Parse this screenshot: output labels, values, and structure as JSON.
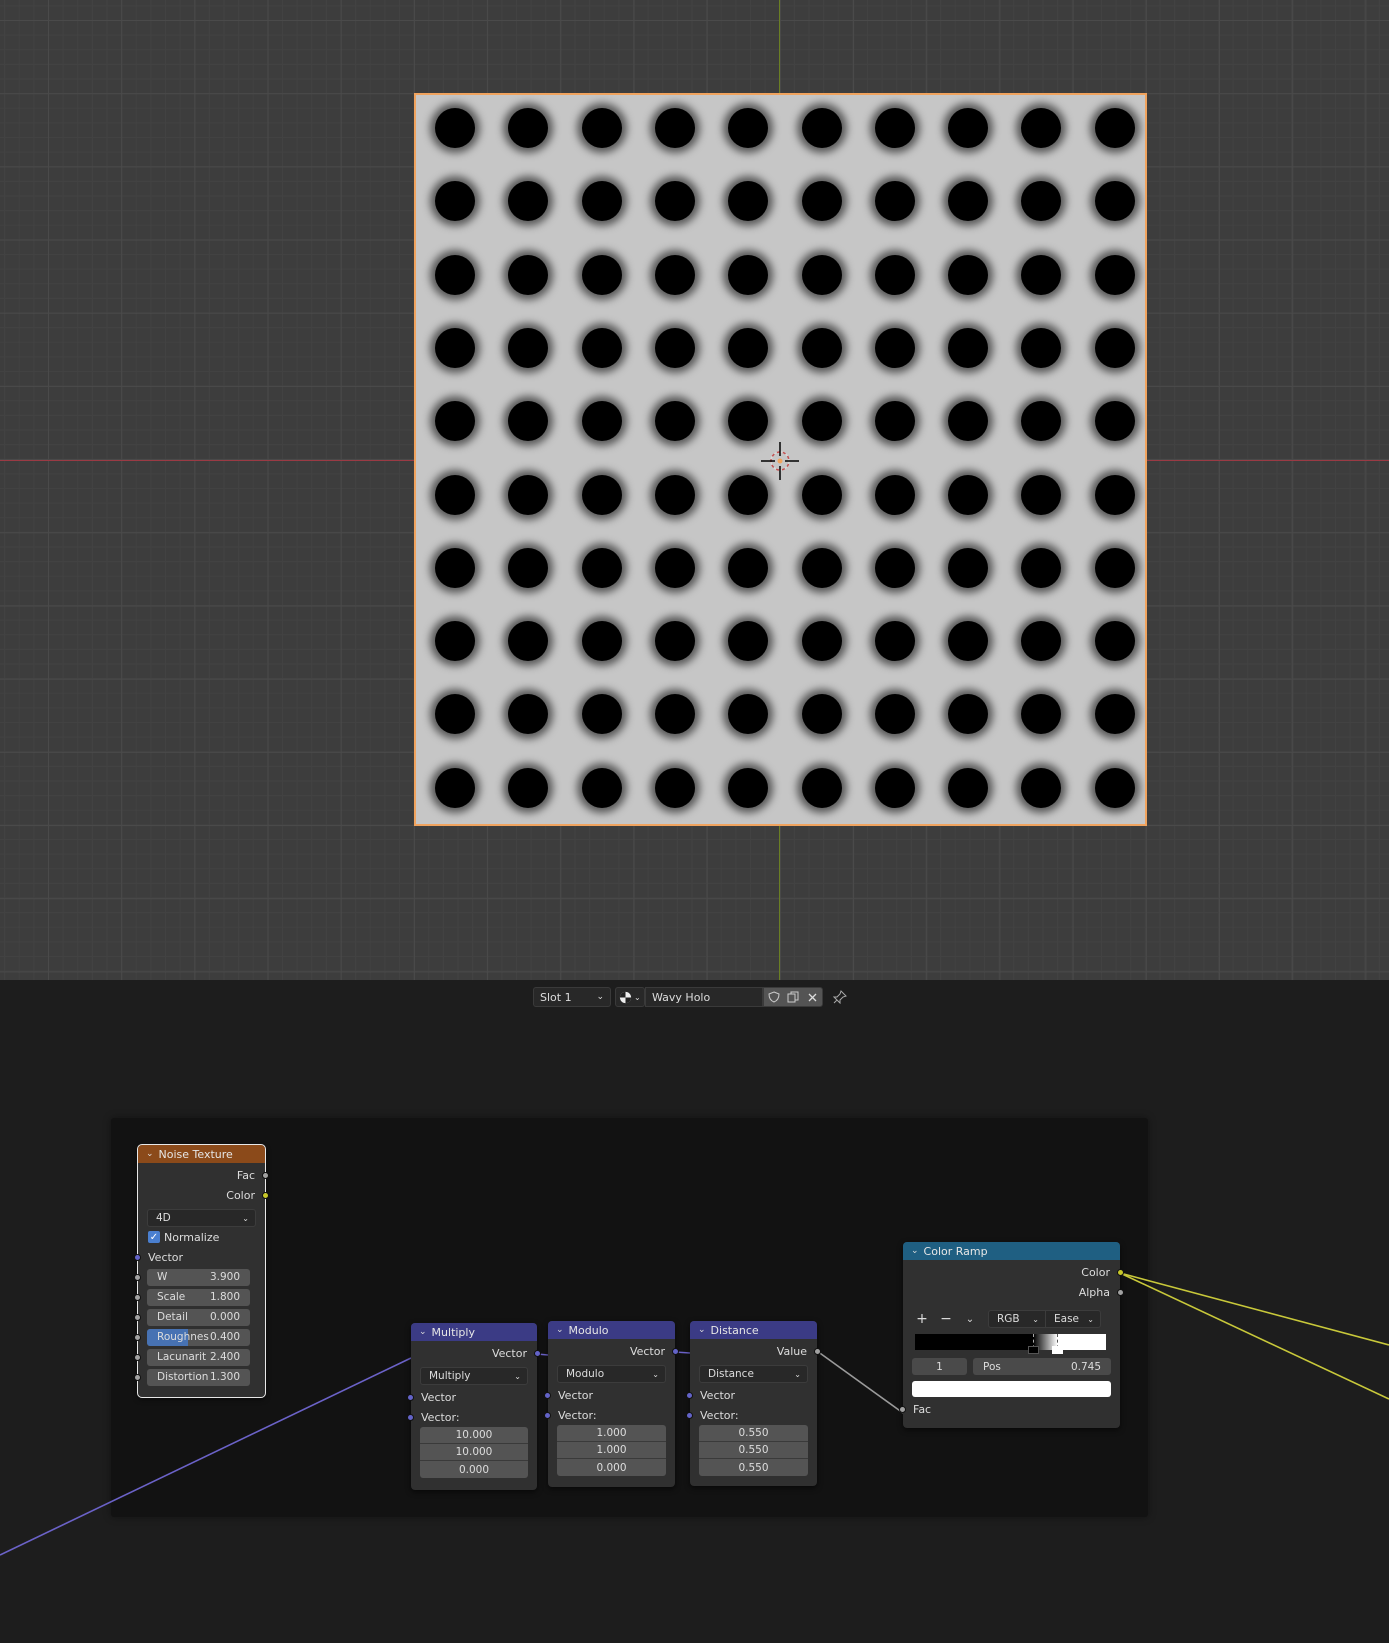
{
  "viewport": {
    "plane": {
      "rows": 10,
      "cols": 10,
      "outline_color": "#f0a35e",
      "surface_color": "#c6c6c6",
      "dot_color": "#000000"
    },
    "axis_colors": {
      "x": "#9a3a44",
      "y": "#6b7f24"
    }
  },
  "header": {
    "slot_label": "Slot 1",
    "material_name": "Wavy Holo",
    "icons": [
      "material-sphere-icon",
      "fake-user-shield-icon",
      "duplicate-icon",
      "close-icon",
      "pin-icon"
    ]
  },
  "nodes": {
    "noise": {
      "title": "Noise Texture",
      "header_color": "#8b4a1a",
      "outputs": [
        "Fac",
        "Color"
      ],
      "dimension": "4D",
      "normalize_label": "Normalize",
      "normalize_checked": true,
      "vector_label": "Vector",
      "fields": [
        {
          "label": "W",
          "value": "3.900"
        },
        {
          "label": "Scale",
          "value": "1.800"
        },
        {
          "label": "Detail",
          "value": "0.000"
        },
        {
          "label": "Roughnes",
          "value": "0.400",
          "fill": 0.4
        },
        {
          "label": "Lacunarit",
          "value": "2.400"
        },
        {
          "label": "Distortion",
          "value": "1.300"
        }
      ]
    },
    "multiply": {
      "title": "Multiply",
      "output": "Vector",
      "operation": "Multiply",
      "input1": "Vector",
      "input2": "Vector:",
      "values": [
        "10.000",
        "10.000",
        "0.000"
      ]
    },
    "modulo": {
      "title": "Modulo",
      "output": "Vector",
      "operation": "Modulo",
      "input1": "Vector",
      "input2": "Vector:",
      "values": [
        "1.000",
        "1.000",
        "0.000"
      ]
    },
    "distance": {
      "title": "Distance",
      "output": "Value",
      "operation": "Distance",
      "input1": "Vector",
      "input2": "Vector:",
      "values": [
        "0.550",
        "0.550",
        "0.550"
      ]
    },
    "colorramp": {
      "title": "Color Ramp",
      "header_color": "#1f5f82",
      "outputs": [
        "Color",
        "Alpha"
      ],
      "color_mode": "RGB",
      "interpolation": "Ease",
      "stops": [
        0.62,
        0.745
      ],
      "active_index": "1",
      "pos_label": "Pos",
      "pos_value": "0.745",
      "input": "Fac"
    }
  }
}
